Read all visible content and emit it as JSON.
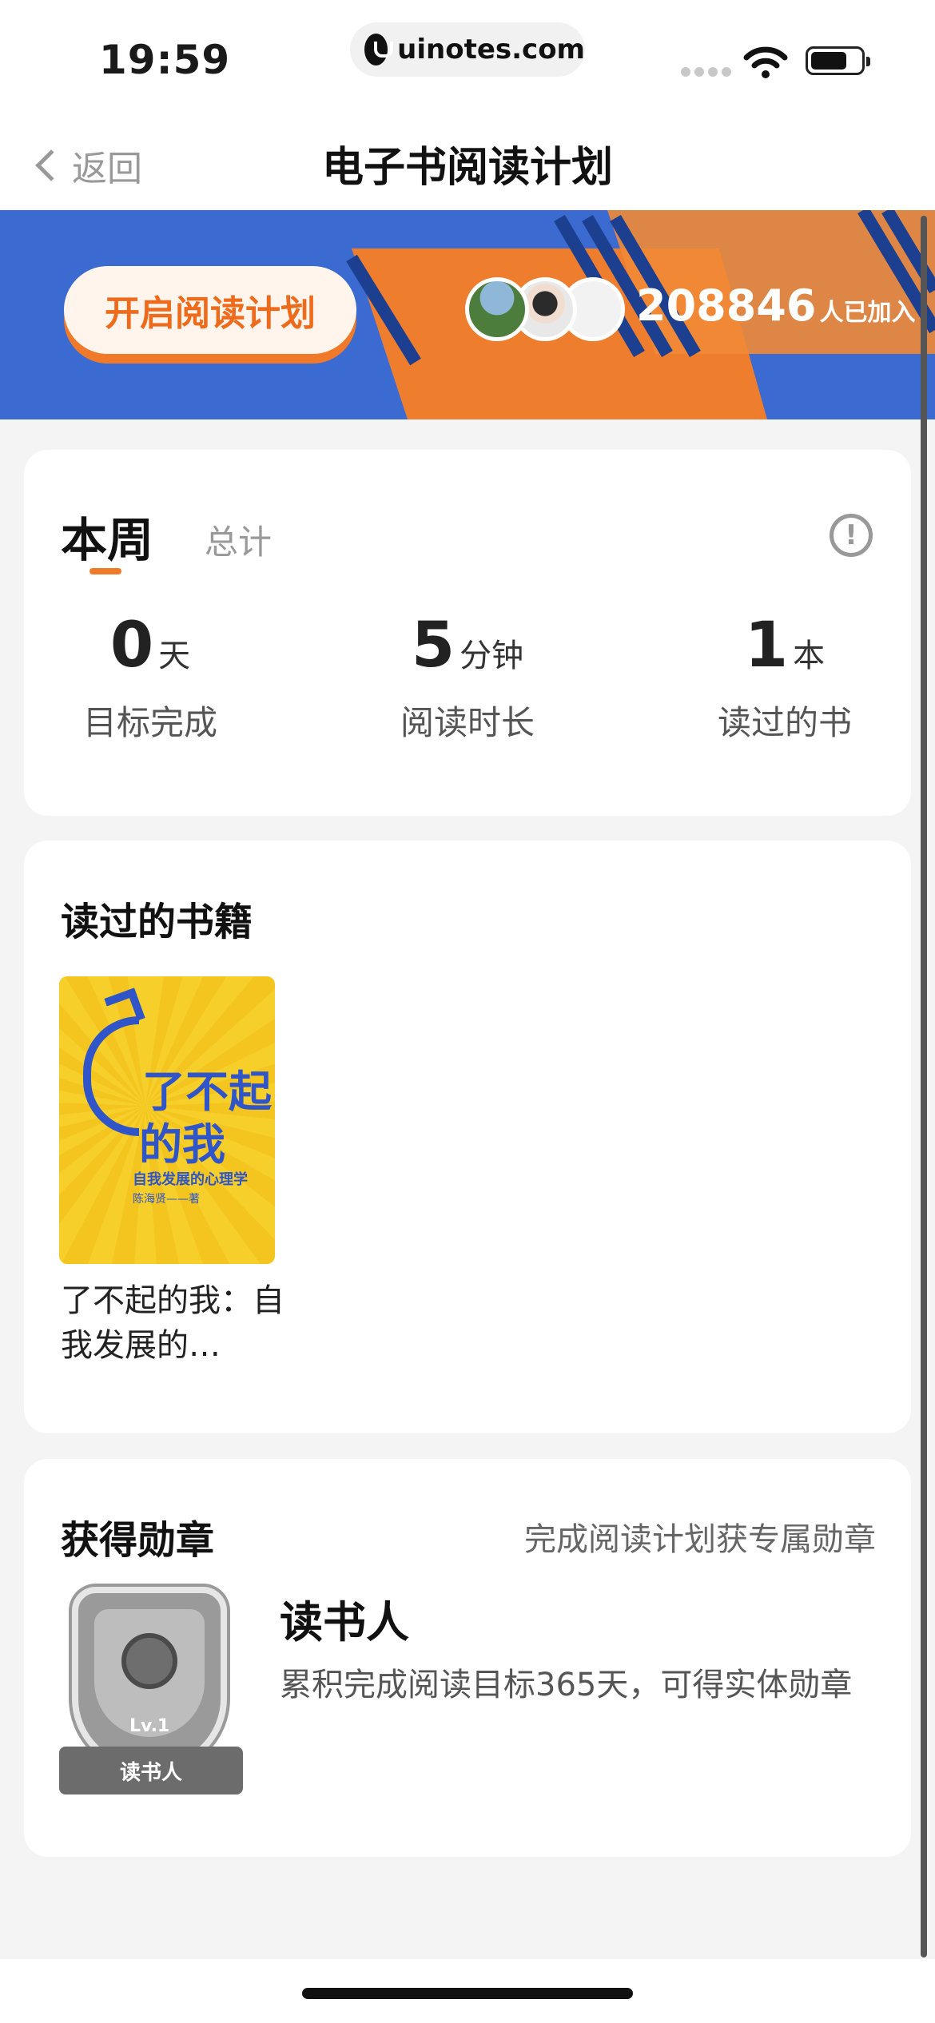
{
  "status_bar": {
    "time": "19:59",
    "url": "uinotes.com"
  },
  "nav": {
    "back_label": "返回",
    "title": "电子书阅读计划"
  },
  "banner": {
    "start_button": "开启阅读计划",
    "joined_count": "208846",
    "joined_suffix": "人已加入",
    "colors": {
      "blue": "#3b6bd0",
      "orange": "#f07a2a"
    }
  },
  "stats": {
    "tabs": [
      "本周",
      "总计"
    ],
    "active_tab": "本周",
    "items": [
      {
        "value": "0",
        "unit": "天",
        "label": "目标完成"
      },
      {
        "value": "5",
        "unit": "分钟",
        "label": "阅读时长"
      },
      {
        "value": "1",
        "unit": "本",
        "label": "读过的书"
      }
    ]
  },
  "books": {
    "title": "读过的书籍",
    "items": [
      {
        "title": "了不起的我：自我发展的…",
        "cover_title_line1": "了不起",
        "cover_title_line2": "的我",
        "cover_subtitle": "自我发展的心理学",
        "cover_author": "陈海贤——著"
      }
    ]
  },
  "medals": {
    "title": "获得勋章",
    "hint": "完成阅读计划获专属勋章",
    "badge": {
      "level": "Lv.1",
      "ribbon": "读书人",
      "name": "读书人",
      "desc": "累积完成阅读目标365天，可得实体勋章"
    }
  }
}
